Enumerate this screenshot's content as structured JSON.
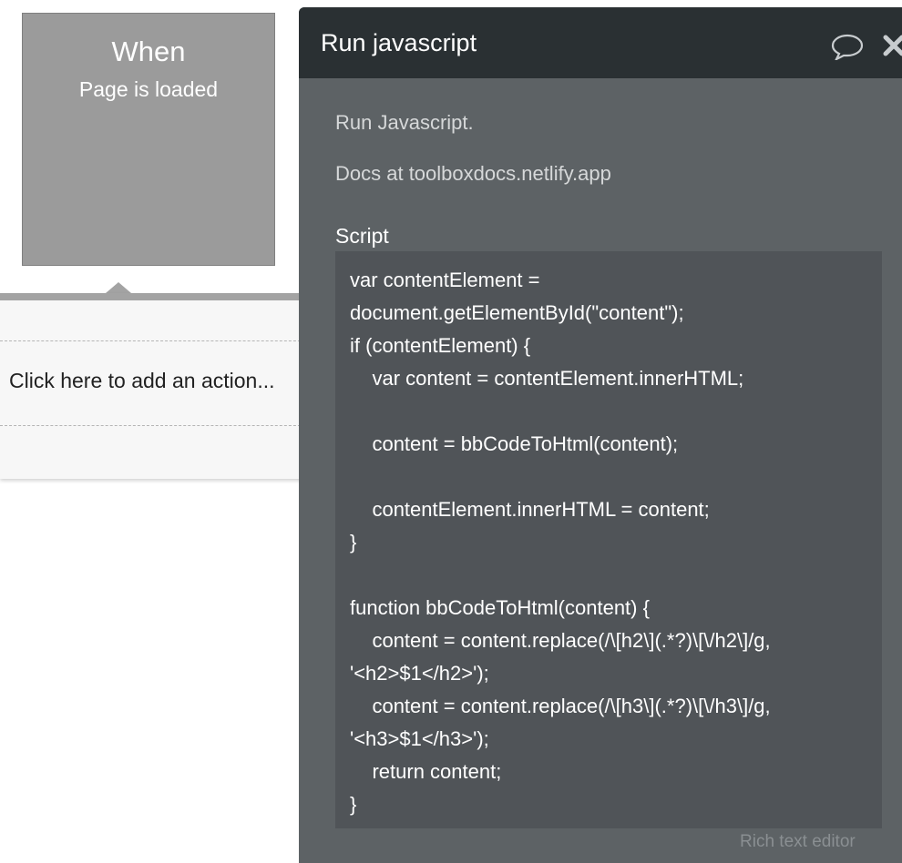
{
  "event": {
    "title": "When",
    "subtitle": "Page is loaded"
  },
  "action_list": {
    "placeholder": "Click here to add an action..."
  },
  "panel": {
    "title": "Run javascript",
    "description": "Run Javascript.",
    "docs": "Docs at toolboxdocs.netlify.app",
    "script_label": "Script",
    "script_value": "var contentElement = document.getElementById(\"content\");\nif (contentElement) {\n    var content = contentElement.innerHTML;\n\n    content = bbCodeToHtml(content);\n\n    contentElement.innerHTML = content;\n}\n\nfunction bbCodeToHtml(content) {\n    content = content.replace(/\\[h2\\](.*?)\\[\\/h2\\]/g, '<h2>$1</h2>');\n    content = content.replace(/\\[h3\\](.*?)\\[\\/h3\\]/g, '<h3>$1</h3>');\n    return content;\n}",
    "rich_text_link": "Rich text editor",
    "icons": [
      "comment-icon",
      "close-icon"
    ]
  },
  "colors": {
    "panel_header": "#2a3033",
    "panel_body": "#5d6265",
    "script_bg": "#505458",
    "event_card": "#9b9b9b"
  }
}
